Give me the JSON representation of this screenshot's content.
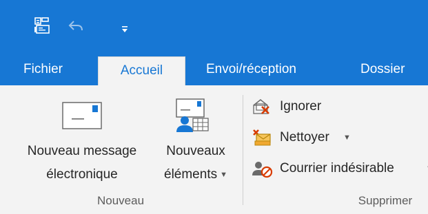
{
  "quick_access": {
    "icons": [
      "send-receive-icon",
      "undo-icon",
      "customize-qat-icon"
    ]
  },
  "tabs": [
    {
      "label": "Fichier",
      "active": false
    },
    {
      "label": "Accueil",
      "active": true
    },
    {
      "label": "Envoi/réception",
      "active": false
    },
    {
      "label": "Dossier",
      "active": false
    }
  ],
  "groups": {
    "nouveau": {
      "label": "Nouveau",
      "new_email": {
        "line1": "Nouveau message",
        "line2": "électronique",
        "icon": "new-email-icon"
      },
      "new_items": {
        "line1": "Nouveaux",
        "line2": "éléments",
        "icon": "new-items-icon"
      }
    },
    "supprimer": {
      "label": "Supprimer",
      "ignore": {
        "label": "Ignorer",
        "icon": "ignore-icon"
      },
      "clean_up": {
        "label": "Nettoyer",
        "icon": "clean-up-icon"
      },
      "junk": {
        "label": "Courrier indésirable",
        "icon": "junk-mail-icon"
      }
    }
  },
  "colors": {
    "brand_blue": "#1777d4",
    "ribbon_bg": "#f3f3f3",
    "text": "#262626",
    "delete_red": "#d83b01"
  }
}
